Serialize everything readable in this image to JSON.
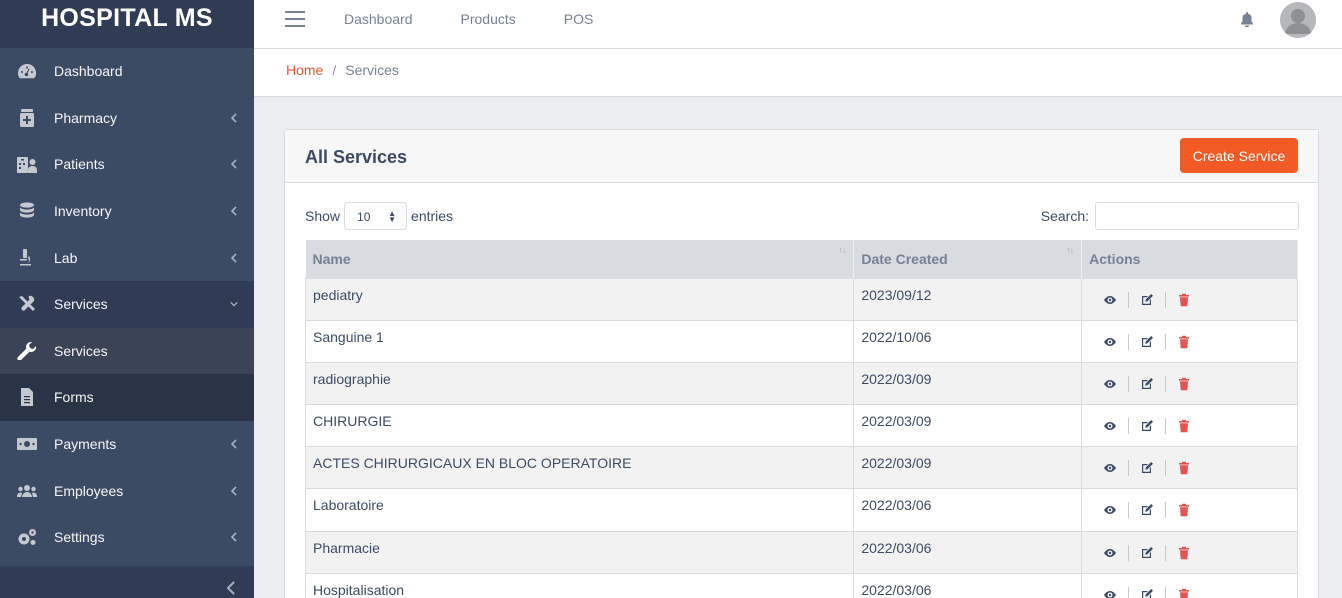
{
  "brand": "HOSPITAL MS",
  "sidebar": {
    "items": [
      {
        "label": "Dashboard",
        "icon": "gauge-icon",
        "chevron": false
      },
      {
        "label": "Pharmacy",
        "icon": "medkit-icon",
        "chevron": true
      },
      {
        "label": "Patients",
        "icon": "hospital-user-icon",
        "chevron": true
      },
      {
        "label": "Inventory",
        "icon": "database-icon",
        "chevron": true
      },
      {
        "label": "Lab",
        "icon": "microscope-icon",
        "chevron": true
      },
      {
        "label": "Services",
        "icon": "tools-icon",
        "chevron": true,
        "open": true
      },
      {
        "label": "Services",
        "icon": "wrench-icon",
        "sub": true,
        "active": true
      },
      {
        "label": "Forms",
        "icon": "file-icon",
        "sub": true
      },
      {
        "label": "Payments",
        "icon": "money-icon",
        "chevron": true
      },
      {
        "label": "Employees",
        "icon": "users-icon",
        "chevron": true
      },
      {
        "label": "Settings",
        "icon": "cogs-icon",
        "chevron": true
      }
    ]
  },
  "header": {
    "nav": [
      "Dashboard",
      "Products",
      "POS"
    ]
  },
  "breadcrumb": {
    "home": "Home",
    "separator": "/",
    "current": "Services"
  },
  "card": {
    "title": "All Services",
    "create_label": "Create Service",
    "show_label": "Show",
    "entries_value": "10",
    "entries_label": "entries",
    "search_label": "Search:"
  },
  "table": {
    "headers": [
      "Name",
      "Date Created",
      "Actions"
    ],
    "rows": [
      {
        "name": "pediatry",
        "date": "2023/09/12"
      },
      {
        "name": "Sanguine 1",
        "date": "2022/10/06"
      },
      {
        "name": "radiographie",
        "date": "2022/03/09"
      },
      {
        "name": "CHIRURGIE",
        "date": "2022/03/09"
      },
      {
        "name": "ACTES CHIRURGICAUX EN BLOC OPERATOIRE",
        "date": "2022/03/09"
      },
      {
        "name": "Laboratoire",
        "date": "2022/03/06"
      },
      {
        "name": "Pharmacie",
        "date": "2022/03/06"
      },
      {
        "name": "Hospitalisation",
        "date": "2022/03/06"
      }
    ]
  },
  "colors": {
    "sidebar": "#3c4b64",
    "accent": "#f15a24",
    "delete": "#e55353"
  }
}
